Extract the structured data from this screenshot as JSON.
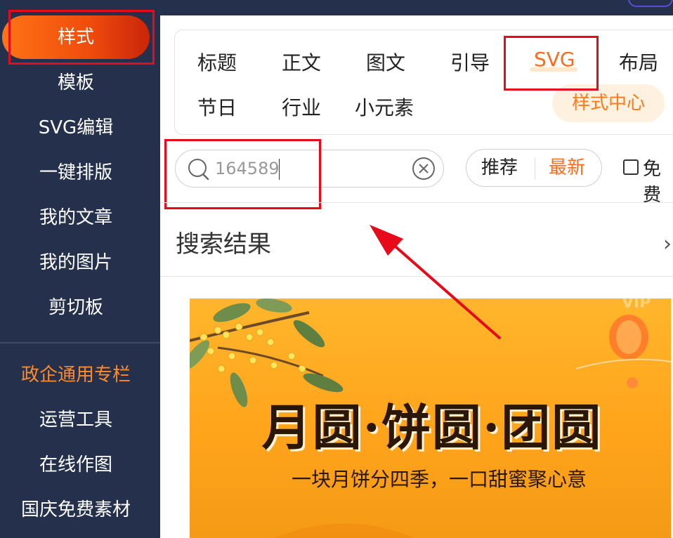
{
  "sidebar": {
    "items": [
      {
        "label": "样式"
      },
      {
        "label": "模板"
      },
      {
        "label": "SVG编辑"
      },
      {
        "label": "一键排版"
      },
      {
        "label": "我的文章"
      },
      {
        "label": "我的图片"
      },
      {
        "label": "剪切板"
      },
      {
        "label": "政企通用专栏"
      },
      {
        "label": "运营工具"
      },
      {
        "label": "在线作图"
      },
      {
        "label": "国庆免费素材"
      }
    ]
  },
  "categories": {
    "row1": [
      "标题",
      "正文",
      "图文",
      "引导",
      "SVG",
      "布局"
    ],
    "row2": [
      "节日",
      "行业",
      "小元素"
    ],
    "active": "SVG",
    "style_center": "样式中心"
  },
  "search": {
    "value": "164589",
    "sort_recommend": "推荐",
    "sort_latest": "最新",
    "free_label": "免费"
  },
  "results": {
    "title": "搜索结果"
  },
  "banner": {
    "title": "月圆·饼圆·团圆",
    "subtitle": "一块月饼分四季，一口甜蜜聚心意",
    "badge": "VIP"
  },
  "colors": {
    "sidebar_bg": "#25314c",
    "accent_orange": "#ff6b1a",
    "highlight_red": "#e60a1a"
  }
}
